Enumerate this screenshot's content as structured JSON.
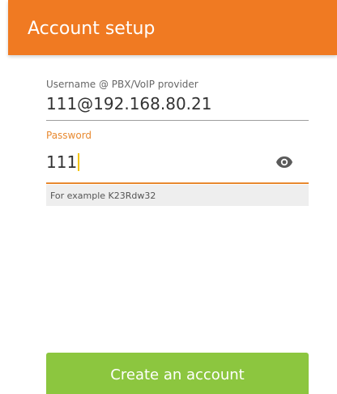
{
  "header": {
    "title": "Account setup",
    "color": "#f07a22"
  },
  "form": {
    "username": {
      "label": "Username @ PBX/VoIP provider",
      "value": "111@192.168.80.21"
    },
    "password": {
      "label": "Password",
      "value": "111",
      "accent_color": "#e8892f",
      "toggle_icon": "eye-icon"
    },
    "hint": "For example K23Rdw32"
  },
  "actions": {
    "create_label": "Create an account",
    "create_color": "#8cc63f"
  }
}
